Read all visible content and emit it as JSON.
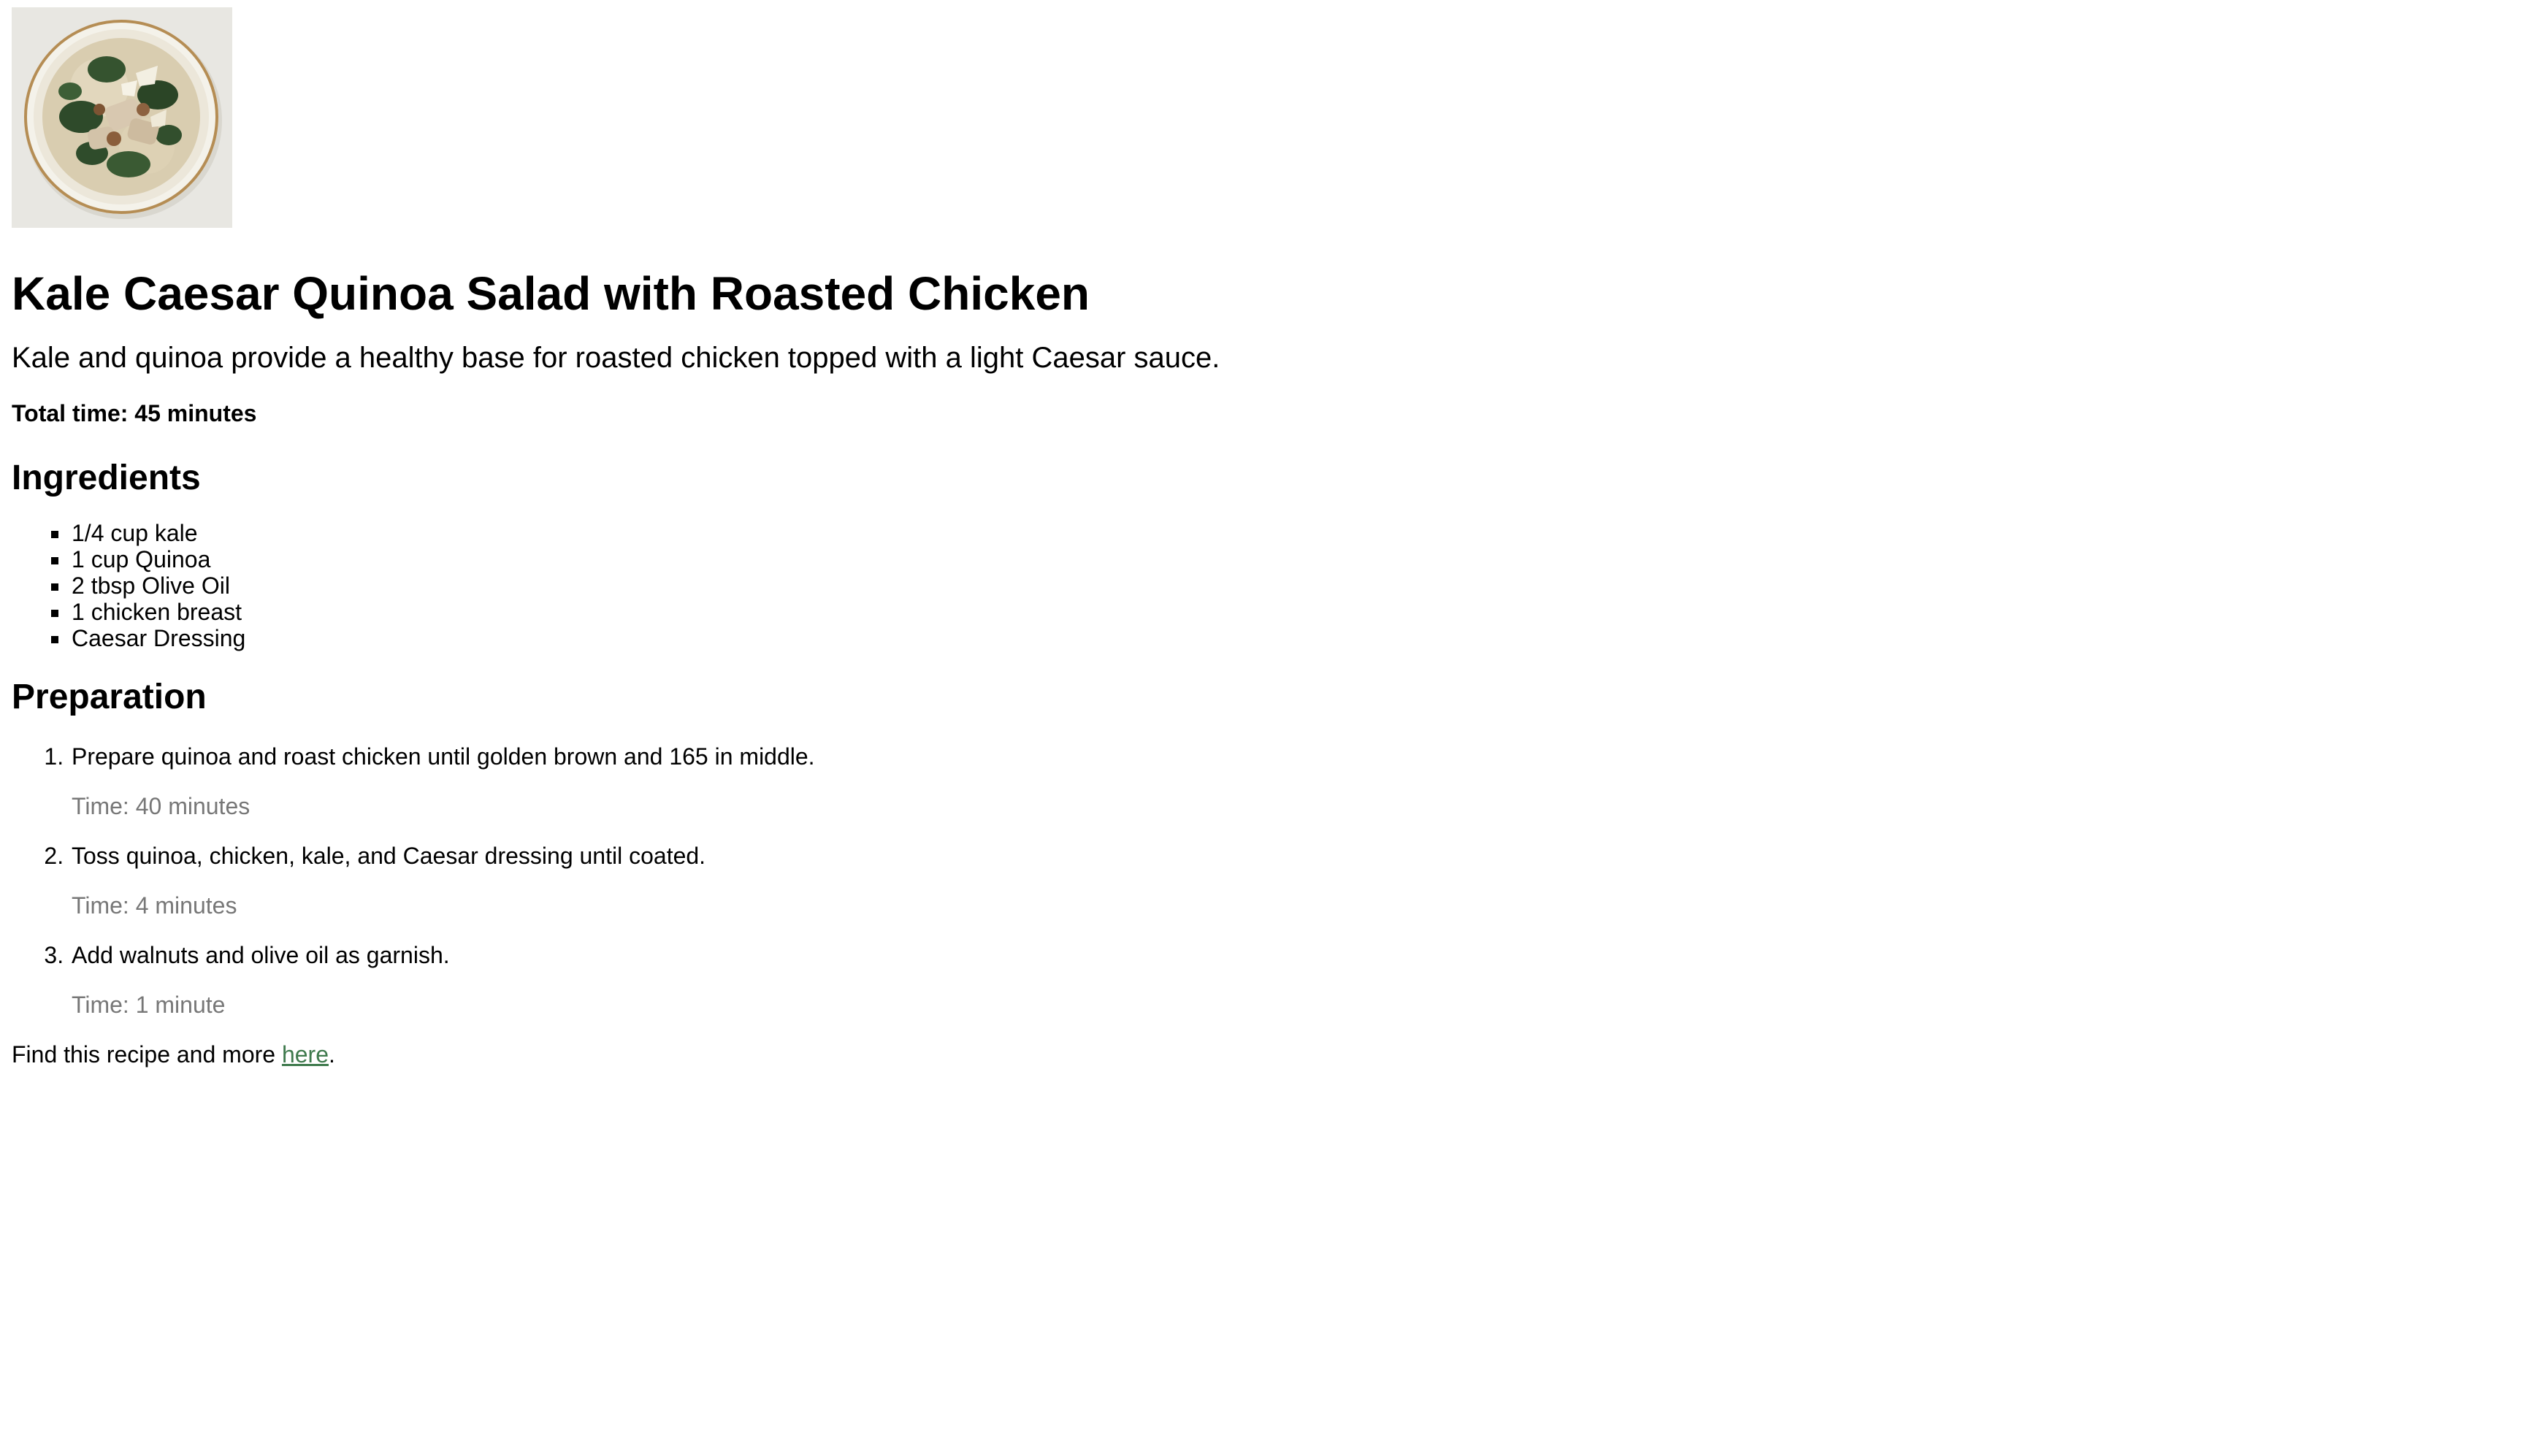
{
  "recipe": {
    "title": "Kale Caesar Quinoa Salad with Roasted Chicken",
    "description": "Kale and quinoa provide a healthy base for roasted chicken topped with a light Caesar sauce.",
    "total_time": "Total time: 45 minutes"
  },
  "ingredients": {
    "heading": "Ingredients",
    "items": [
      "1/4 cup kale",
      "1 cup Quinoa",
      "2 tbsp Olive Oil",
      "1 chicken breast",
      "Caesar Dressing"
    ]
  },
  "preparation": {
    "heading": "Preparation",
    "steps": [
      {
        "text": "Prepare quinoa and roast chicken until golden brown and 165 in middle.",
        "time": "Time: 40 minutes"
      },
      {
        "text": "Toss quinoa, chicken, kale, and Caesar dressing until coated.",
        "time": "Time: 4 minutes"
      },
      {
        "text": "Add walnuts and olive oil as garnish.",
        "time": "Time: 1 minute"
      }
    ]
  },
  "footer": {
    "prefix": "Find this recipe and more ",
    "link_text": "here",
    "suffix": "."
  },
  "colors": {
    "link": "#3f7a4d",
    "step_time": "#777777"
  }
}
